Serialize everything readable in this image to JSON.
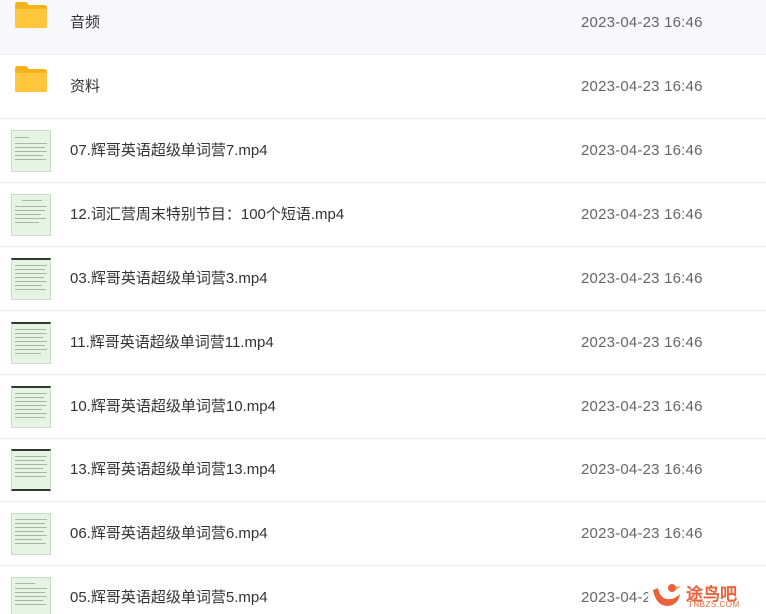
{
  "files": [
    {
      "type": "folder",
      "name": "音频",
      "date": "2023-04-23 16:46"
    },
    {
      "type": "folder",
      "name": "资料",
      "date": "2023-04-23 16:46"
    },
    {
      "type": "video",
      "name": "07.辉哥英语超级单词营7.mp4",
      "date": "2023-04-23 16:46"
    },
    {
      "type": "video",
      "name": "12.词汇营周末特别节目：100个短语.mp4",
      "date": "2023-04-23 16:46"
    },
    {
      "type": "video",
      "name": "03.辉哥英语超级单词营3.mp4",
      "date": "2023-04-23 16:46"
    },
    {
      "type": "video",
      "name": "11.辉哥英语超级单词营11.mp4",
      "date": "2023-04-23 16:46"
    },
    {
      "type": "video",
      "name": "10.辉哥英语超级单词营10.mp4",
      "date": "2023-04-23 16:46"
    },
    {
      "type": "video",
      "name": "13.辉哥英语超级单词营13.mp4",
      "date": "2023-04-23 16:46"
    },
    {
      "type": "video",
      "name": "06.辉哥英语超级单词营6.mp4",
      "date": "2023-04-23 16:46"
    },
    {
      "type": "video",
      "name": "05.辉哥英语超级单词营5.mp4",
      "date": "2023-04-2"
    }
  ],
  "watermark": {
    "text": "途鸟吧",
    "sub": "TNBZS.COM"
  },
  "colors": {
    "folder": "#ffc53d",
    "folder_tab": "#f5b21b",
    "thumb_bg": "#e6f4e4",
    "watermark": "#e8623a"
  }
}
